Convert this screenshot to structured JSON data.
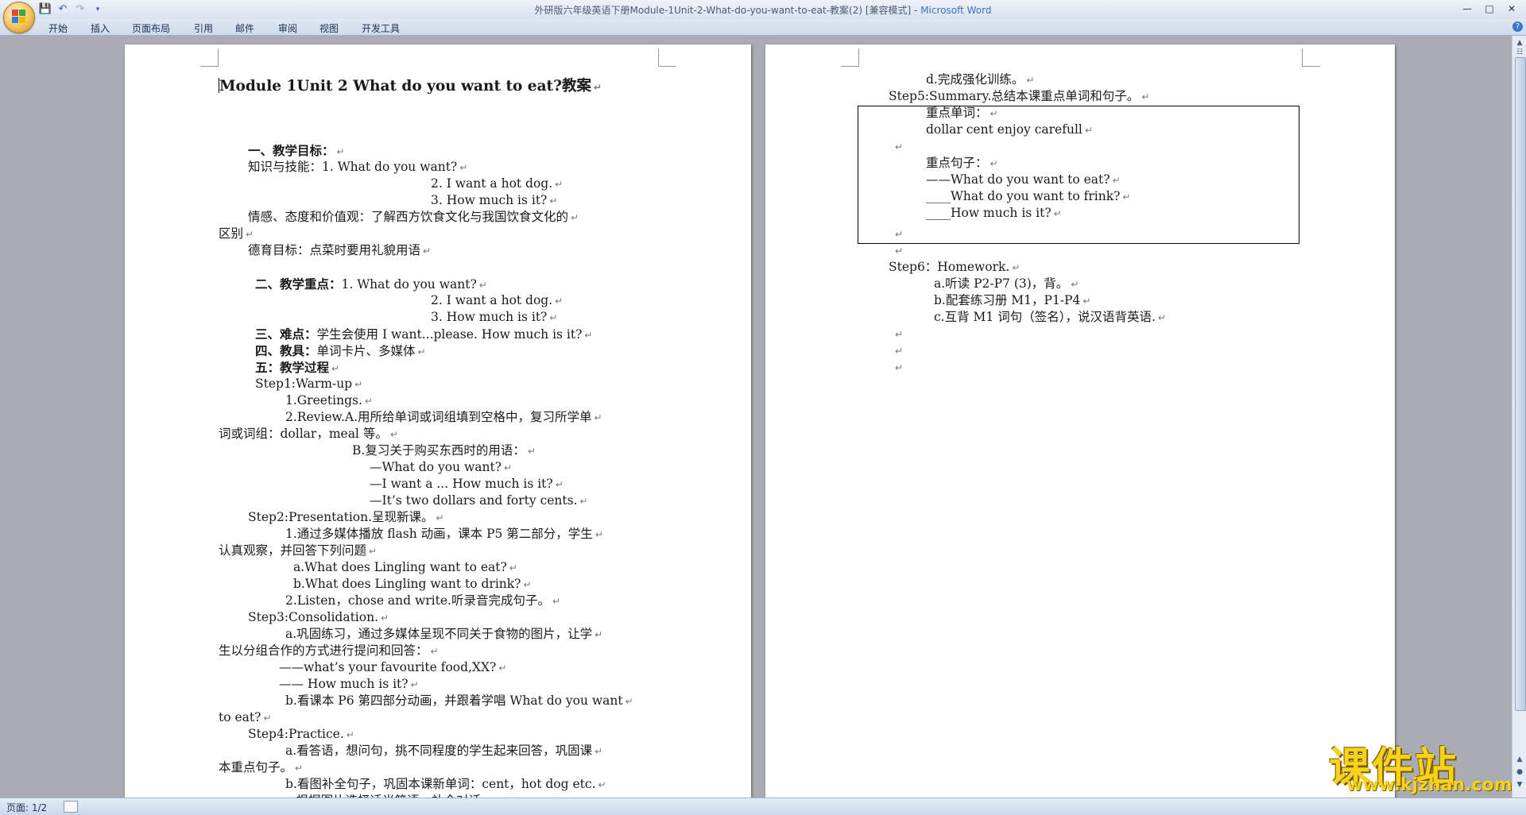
{
  "window": {
    "title": "外研版六年级英语下册Module-1Unit-2-What-do-you-want-to-eat-教案(2) [兼容模式]",
    "title_sep": " - ",
    "app_name": "Microsoft Word",
    "controls": [
      "minimize-icon",
      "maximize-icon",
      "close-icon"
    ]
  },
  "qat": [
    "save-icon",
    "undo-icon",
    "redo-icon",
    "customize-icon"
  ],
  "ribbon": {
    "tabs": [
      "开始",
      "插入",
      "页面布局",
      "引用",
      "邮件",
      "审阅",
      "视图",
      "开发工具"
    ],
    "help": "?"
  },
  "para_mark": "↵",
  "page1": {
    "title": "Module 1Unit 2   What do you want to eat?教案",
    "lines": [
      {
        "text": "一、教学目标：",
        "bold": true
      },
      {
        "text": "知识与技能：1. What do you want?"
      },
      {
        "text": "2. I want a hot dog."
      },
      {
        "text": "3. How much is it?"
      },
      {
        "text": "情感、态度和价值观：了解西方饮食文化与我国饮食文化的"
      },
      {
        "text": "区别"
      },
      {
        "text": "德育目标：点菜时要用礼貌用语"
      },
      {
        "text": "二、教学重点：",
        "bold": true,
        "rest": "1. What do you want?"
      },
      {
        "text": "2. I want a hot dog."
      },
      {
        "text": "3. How much is it?"
      },
      {
        "text": "三、难点：",
        "bold": true,
        "rest": "学生会使用 I want...please. How much is it?"
      },
      {
        "text": "四、教具：",
        "bold": true,
        "rest": "单词卡片、多媒体"
      },
      {
        "text": "五：教学过程",
        "bold": true
      },
      {
        "text": "Step1:Warm-up"
      },
      {
        "text": "1.Greetings."
      },
      {
        "text": "2.Review.A.用所给单词或词组填到空格中，复习所学单"
      },
      {
        "text": "词或词组：dollar，meal 等。"
      },
      {
        "text": "B.复习关于购买东西时的用语："
      },
      {
        "text": "—What do you want?"
      },
      {
        "text": "—I want a ... How much is it?"
      },
      {
        "text": "—It’s two dollars and forty cents."
      },
      {
        "text": "Step2:Presentation.呈现新课。"
      },
      {
        "text": "1.通过多媒体播放 flash 动画，课本 P5 第二部分，学生"
      },
      {
        "text": "认真观察，并回答下列问题"
      },
      {
        "text": "a.What does Lingling want to eat?"
      },
      {
        "text": "b.What does Lingling want to drink?"
      },
      {
        "text": "2.Listen，chose and write.听录音完成句子。"
      },
      {
        "text": "Step3:Consolidation."
      },
      {
        "text": "a.巩固练习，通过多媒体呈现不同关于食物的图片，让学"
      },
      {
        "text": "生以分组合作的方式进行提问和回答："
      },
      {
        "text": "——what’s your favourite food,XX?"
      },
      {
        "text": "—— How much is it?"
      },
      {
        "text": "b.看课本 P6 第四部分动画，并跟着学唱 What do you want"
      },
      {
        "text": "to eat?"
      },
      {
        "text": "Step4:Practice."
      },
      {
        "text": "a.看答语，想问句，挑不同程度的学生起来回答，巩固课"
      },
      {
        "text": "本重点句子。"
      },
      {
        "text": "b.看图补全句子，巩固本课新单词：cent，hot dog etc."
      },
      {
        "text": "c.根据图片选择适当答语，补全对话。"
      }
    ]
  },
  "page2": {
    "lines": [
      {
        "text": "d.完成强化训练。"
      },
      {
        "text": "Step5:Summary.总结本课重点单词和句子。"
      },
      {
        "text": "重点单词："
      },
      {
        "text": "dollar    cent     enjoy     carefull"
      },
      {
        "text": ""
      },
      {
        "text": "重点句子："
      },
      {
        "text": "——What do you want to eat?"
      },
      {
        "text": "____What do you want to frink?"
      },
      {
        "text": "____How much is it?"
      },
      {
        "text": ""
      },
      {
        "text": ""
      },
      {
        "text": "Step6：Homework."
      },
      {
        "text": "a.听读 P2-P7 (3)，背。"
      },
      {
        "text": "b.配套练习册 M1，P1-P4"
      },
      {
        "text": "c.互背 M1 词句（签名），说汉语背英语."
      },
      {
        "text": ""
      },
      {
        "text": ""
      },
      {
        "text": ""
      }
    ]
  },
  "status": {
    "page_indicator": "页面: 1/2"
  },
  "watermark": {
    "brand": "课件站",
    "url": "www.kjzhan.com"
  },
  "colors": {
    "workspace": "#a9acb3",
    "ribbon": "#cfdbeb",
    "title_accent": "#3b6fc4",
    "watermark": "#f7d21a"
  }
}
